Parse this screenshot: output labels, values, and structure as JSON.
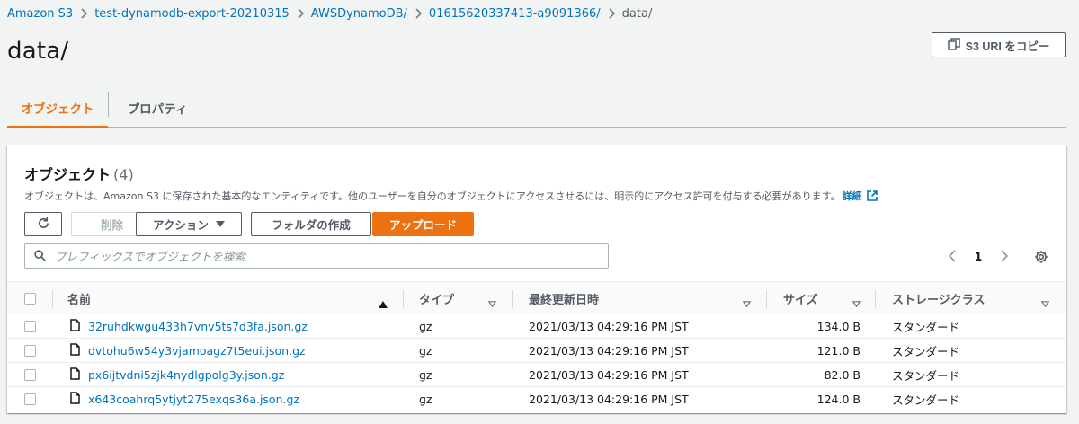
{
  "breadcrumb": [
    {
      "label": "Amazon S3"
    },
    {
      "label": "test-dynamodb-export-20210315"
    },
    {
      "label": "AWSDynamoDB/"
    },
    {
      "label": "01615620337413-a9091366/"
    },
    {
      "label": "data/"
    }
  ],
  "header": {
    "title": "data/",
    "copy_uri_label": "S3 URI をコピー"
  },
  "tabs": [
    {
      "label": "オブジェクト",
      "active": true
    },
    {
      "label": "プロパティ",
      "active": false
    }
  ],
  "panel": {
    "title": "オブジェクト",
    "count": "(4)",
    "description": "オブジェクトは、Amazon S3 に保存された基本的なエンティティです。他のユーザーを自分のオブジェクトにアクセスさせるには、明示的にアクセス許可を付与する必要があります。",
    "info_link": "詳細"
  },
  "toolbar": {
    "delete_label": "削除",
    "actions_label": "アクション",
    "create_folder_label": "フォルダの作成",
    "upload_label": "アップロード"
  },
  "search": {
    "placeholder": "プレフィックスでオブジェクトを検索",
    "value": ""
  },
  "pagination": {
    "current_page": "1"
  },
  "table": {
    "columns": [
      "名前",
      "タイプ",
      "最終更新日時",
      "サイズ",
      "ストレージクラス"
    ],
    "rows": [
      {
        "name": "32ruhdkwgu433h7vnv5ts7d3fa.json.gz",
        "type": "gz",
        "modified": "2021/03/13 04:29:16 PM JST",
        "size": "134.0 B",
        "storage": "スタンダード"
      },
      {
        "name": "dvtohu6w54y3vjamoagz7t5eui.json.gz",
        "type": "gz",
        "modified": "2021/03/13 04:29:16 PM JST",
        "size": "121.0 B",
        "storage": "スタンダード"
      },
      {
        "name": "px6ijtvdni5zjk4nydlgpolg3y.json.gz",
        "type": "gz",
        "modified": "2021/03/13 04:29:16 PM JST",
        "size": "82.0 B",
        "storage": "スタンダード"
      },
      {
        "name": "x643coahrq5ytjyt275exqs36a.json.gz",
        "type": "gz",
        "modified": "2021/03/13 04:29:16 PM JST",
        "size": "124.0 B",
        "storage": "スタンダード"
      }
    ]
  },
  "colors": {
    "link": "#0073bb",
    "accent": "#ec7211",
    "text": "#16191f",
    "muted": "#545b64"
  }
}
